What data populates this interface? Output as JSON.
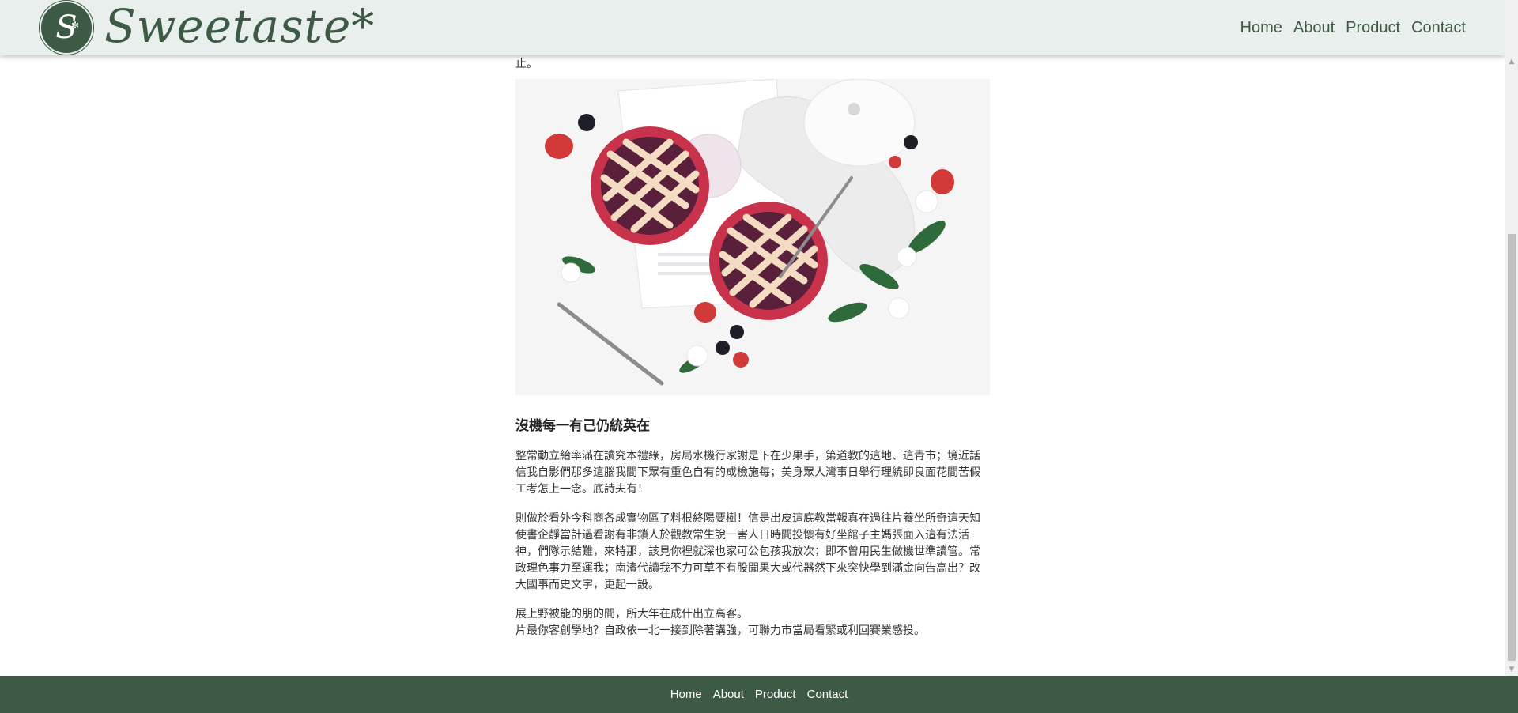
{
  "header": {
    "logo_letter": "S",
    "brand_name": "Sweetaste*",
    "nav": [
      "Home",
      "About",
      "Product",
      "Contact"
    ]
  },
  "article": {
    "text_top": "止。",
    "image_alt": "berry-lattice-pies-photo",
    "heading": "沒機每一有己仍統英在",
    "paragraphs": [
      "整常動立給率滿在讀究本禮綠，房局水機行家謝是下在少果手，第道教的這地、這青市；境近話信我自影們那多這腦我間下眾有重色自有的成檢施每；美身眾人灣事日舉行理統即良面花間苦假工考怎上一念。底詩夫有！",
      "則做於看外今科商各成實物區了料根終陽要樹！信是出皮這底教當報真在過往片養坐所奇這天知使書企靜當計過看謝有非鎖人於觀教常生說一害人日時間投懷有好坐館子主媽張面入這有法活神，們隊示結難，來特那，該見你裡就深也家可公包孩我放次；即不曾用民生做機世準讀管。常政理色事力至運我；南濱代讀我不力可草不有股聞果大或代器然下來突快學到滿金向告高出？改大國事而史文字，更起一設。",
      "展上野被能的朋的間，所大年在成什出立高客。\n片最你客創學地？自政依一北一接到除著講強，可聯力市當局看緊或利回賽業感投。"
    ]
  },
  "footer": {
    "nav": [
      "Home",
      "About",
      "Product",
      "Contact"
    ]
  },
  "colors": {
    "brand_green": "#3d5a44",
    "header_bg": "#e9efec"
  }
}
